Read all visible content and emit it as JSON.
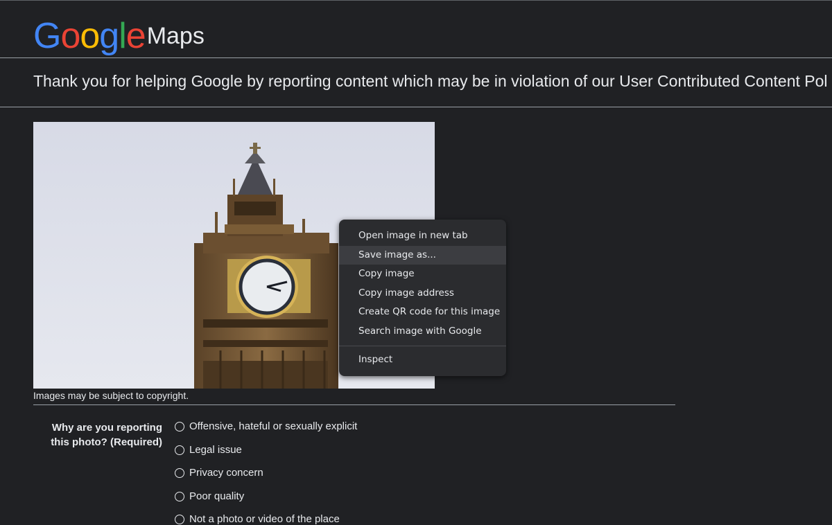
{
  "logo": {
    "letters": [
      {
        "char": "G",
        "color": "#4285F4"
      },
      {
        "char": "o",
        "color": "#EA4335"
      },
      {
        "char": "o",
        "color": "#FBBC05"
      },
      {
        "char": "g",
        "color": "#4285F4"
      },
      {
        "char": "l",
        "color": "#34A853"
      },
      {
        "char": "e",
        "color": "#EA4335"
      }
    ],
    "product": "Maps"
  },
  "header": {
    "thanks_text": "Thank you for helping Google by reporting content which may be in violation of our User Contributed Content Pol"
  },
  "photo": {
    "copyright_notice": "Images may be subject to copyright."
  },
  "context_menu": {
    "items": [
      "Open image in new tab",
      "Save image as...",
      "Copy image",
      "Copy image address",
      "Create QR code for this image",
      "Search image with Google"
    ],
    "inspect": "Inspect",
    "hovered_item": "Save image as..."
  },
  "form": {
    "question": "Why are you reporting this photo? (Required)",
    "options": [
      "Offensive, hateful or sexually explicit",
      "Legal issue",
      "Privacy concern",
      "Poor quality",
      "Not a photo or video of the place"
    ]
  },
  "colors": {
    "background": "#202124",
    "menu_background": "#2b2c2f",
    "menu_hover": "#3c3d41"
  }
}
